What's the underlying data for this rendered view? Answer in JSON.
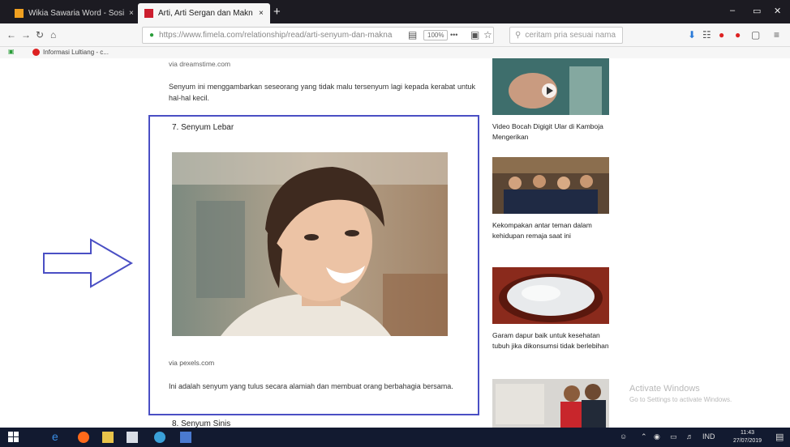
{
  "browser": {
    "tabs": [
      {
        "title": "Wikia Sawaria Word - Sosia",
        "close": "×"
      },
      {
        "title": "Arti, Arti Sergan dan Makn",
        "close": "×"
      }
    ],
    "new_tab": "+",
    "window_controls": {
      "minimize": "–",
      "maximize": "▭",
      "close": "✕"
    },
    "url": "https://www.fimela.com/relationship/read/arti-senyum-dan-makna",
    "zoom": "100%",
    "more": "•••",
    "search_placeholder": "ceritam pria sesuai nama",
    "bookmark": "Informasi Lultiang - c..."
  },
  "article": {
    "top_label": "via dreamstime.com",
    "intro": "Senyum ini menggambarkan seseorang yang tidak malu tersenyum lagi kepada kerabat untuk hal-hal kecil.",
    "section_title": "7. Senyum Lebar",
    "caption": "via pexels.com",
    "body": "Ini adalah senyum yang tulus secara alamiah dan membuat orang berbahagia bersama.",
    "next_title": "8. Senyum Sinis"
  },
  "sidebar": [
    {
      "caption": "Video Bocah Digigit Ular di Kamboja Mengerikan"
    },
    {
      "caption": "Kekompakan antar teman dalam kehidupan remaja saat ini"
    },
    {
      "caption": "Garam dapur baik untuk kesehatan tubuh jika dikonsumsi tidak berlebihan"
    },
    {
      "caption": ""
    }
  ],
  "watermark": {
    "line1": "Activate Windows",
    "line2": "Go to Settings to activate Windows."
  },
  "taskbar": {
    "time": "11:43",
    "date": "27/07/2019",
    "lang": "IND"
  },
  "colors": {
    "highlight": "#4a4fc4",
    "arrow": "#4a4fc4"
  }
}
